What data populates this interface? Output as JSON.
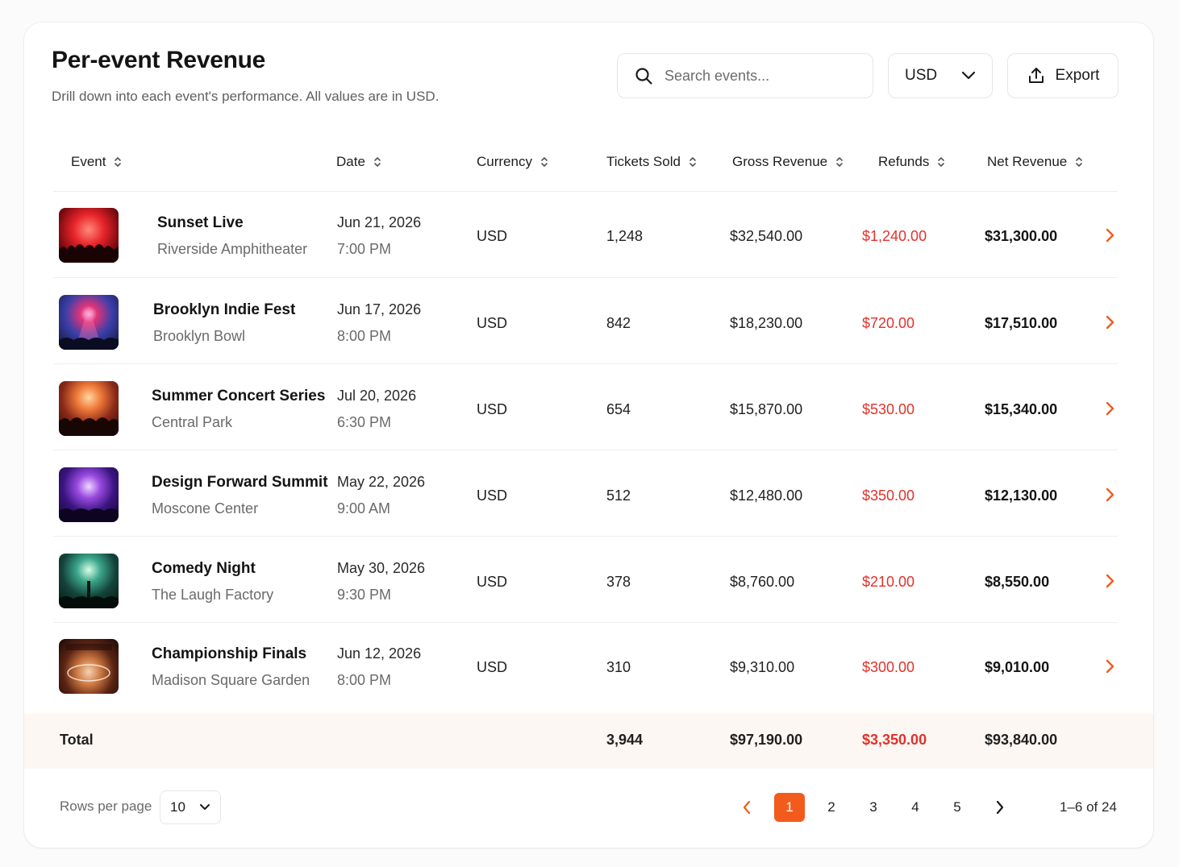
{
  "header": {
    "title": "Per-event Revenue",
    "subtitle": "Drill down into each event's performance. All values are in USD."
  },
  "toolbar": {
    "search_placeholder": "Search events...",
    "currency_selected": "USD",
    "export_label": "Export"
  },
  "columns": [
    "Event",
    "Date",
    "Currency",
    "Tickets Sold",
    "Gross Revenue",
    "Refunds",
    "Net Revenue"
  ],
  "rows": [
    {
      "name": "Sunset Live",
      "venue": "Riverside Amphitheater",
      "date": "Jun 21, 2026",
      "time": "7:00 PM",
      "currency": "USD",
      "tickets": "1,248",
      "gross": "$32,540.00",
      "refunds": "$1,240.00",
      "net": "$31,300.00"
    },
    {
      "name": "Brooklyn Indie Fest",
      "venue": "Brooklyn Bowl",
      "date": "Jun 17, 2026",
      "time": "8:00 PM",
      "currency": "USD",
      "tickets": "842",
      "gross": "$18,230.00",
      "refunds": "$720.00",
      "net": "$17,510.00"
    },
    {
      "name": "Summer Concert Series",
      "venue": "Central Park",
      "date": "Jul 20, 2026",
      "time": "6:30 PM",
      "currency": "USD",
      "tickets": "654",
      "gross": "$15,870.00",
      "refunds": "$530.00",
      "net": "$15,340.00"
    },
    {
      "name": "Design Forward Summit",
      "venue": "Moscone Center",
      "date": "May 22, 2026",
      "time": "9:00 AM",
      "currency": "USD",
      "tickets": "512",
      "gross": "$12,480.00",
      "refunds": "$350.00",
      "net": "$12,130.00"
    },
    {
      "name": "Comedy Night",
      "venue": "The Laugh Factory",
      "date": "May 30, 2026",
      "time": "9:30 PM",
      "currency": "USD",
      "tickets": "378",
      "gross": "$8,760.00",
      "refunds": "$210.00",
      "net": "$8,550.00"
    },
    {
      "name": "Championship Finals",
      "venue": "Madison Square Garden",
      "date": "Jun 12, 2026",
      "time": "8:00 PM",
      "currency": "USD",
      "tickets": "310",
      "gross": "$9,310.00",
      "refunds": "$300.00",
      "net": "$9,010.00"
    }
  ],
  "totals": {
    "label": "Total",
    "tickets": "3,944",
    "gross": "$97,190.00",
    "refunds": "$3,350.00",
    "net": "$93,840.00"
  },
  "footer": {
    "rows_per_page_label": "Rows per page",
    "rows_per_page_value": "10",
    "pages": [
      "1",
      "2",
      "3",
      "4",
      "5"
    ],
    "current_page": "1",
    "range_text": "1–6 of 24"
  },
  "colors": {
    "accent": "#f35b1d",
    "refund": "#e0322a",
    "total_bg": "#fcf7f3"
  },
  "icons": {
    "search": "search-icon",
    "chevron_down": "chevron-down-icon",
    "export": "upload-icon",
    "sort": "sort-icon",
    "row_open": "chevron-right-icon",
    "prev": "chevron-left-icon",
    "next": "chevron-right-icon"
  }
}
